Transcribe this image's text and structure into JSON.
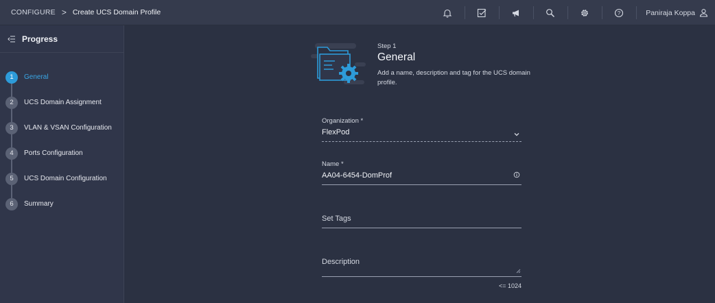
{
  "breadcrumb": {
    "root": "CONFIGURE",
    "separator": ">",
    "current": "Create UCS Domain Profile"
  },
  "toolbar": {
    "icons": [
      "bell-icon",
      "task-check-icon",
      "megaphone-icon",
      "search-icon",
      "settings-gear-icon",
      "help-icon"
    ],
    "user_name": "Paniraja Koppa"
  },
  "sidebar": {
    "title": "Progress",
    "steps": [
      {
        "num": "1",
        "label": "General",
        "active": true
      },
      {
        "num": "2",
        "label": "UCS Domain Assignment"
      },
      {
        "num": "3",
        "label": "VLAN & VSAN Configuration"
      },
      {
        "num": "4",
        "label": "Ports Configuration"
      },
      {
        "num": "5",
        "label": "UCS Domain Configuration"
      },
      {
        "num": "6",
        "label": "Summary"
      }
    ]
  },
  "main": {
    "step_label": "Step 1",
    "step_title": "General",
    "step_description": "Add a name, description and tag for the UCS domain profile.",
    "fields": {
      "organization": {
        "label": "Organization *",
        "value": "FlexPod"
      },
      "name": {
        "label": "Name *",
        "value": "AA04-6454-DomProf"
      },
      "tags": {
        "placeholder": "Set Tags"
      },
      "description": {
        "placeholder": "Description",
        "counter": "<= 1024"
      }
    }
  },
  "colors": {
    "accent": "#2d9bd9",
    "background": "#2b3142",
    "topbar": "#353b4d",
    "sidebar": "#30364a"
  }
}
